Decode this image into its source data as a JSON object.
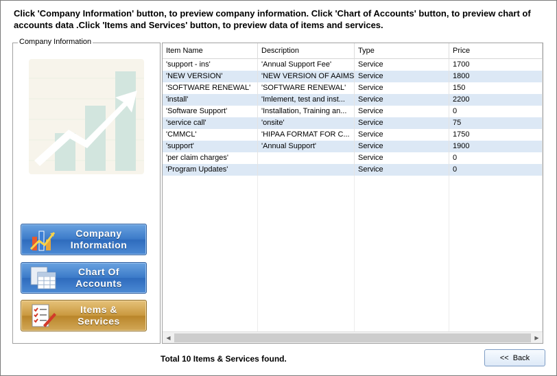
{
  "instructions": "Click 'Company Information' button, to preview company information. Click 'Chart of Accounts' button, to preview chart of accounts data .Click 'Items and Services' button, to preview data of items and services.",
  "groupbox": {
    "legend": "Company Information"
  },
  "nav": {
    "company": {
      "line1": "Company",
      "line2": "Information",
      "icon": "bar-chart-icon"
    },
    "accounts": {
      "line1": "Chart Of",
      "line2": "Accounts",
      "icon": "spreadsheet-icon"
    },
    "items": {
      "line1": "Items &",
      "line2": "Services",
      "icon": "checklist-icon"
    }
  },
  "colors": {
    "row_alt": "#dce8f5",
    "blue_button": "#3a79c8",
    "gold_button": "#c9983e"
  },
  "table": {
    "columns": [
      "Item Name",
      "Description",
      "Type",
      "Price"
    ],
    "rows": [
      [
        "'support - ins'",
        "'Annual Support Fee'",
        "Service",
        "1700"
      ],
      [
        "'NEW VERSION'",
        "'NEW VERSION OF AAIMS'",
        "Service",
        "1800"
      ],
      [
        "'SOFTWARE RENEWAL'",
        "'SOFTWARE RENEWAL'",
        "Service",
        "150"
      ],
      [
        "'install'",
        "'Imlement, test and inst...",
        "Service",
        "2200"
      ],
      [
        "'Software Support'",
        "'Installation, Training an...",
        "Service",
        "0"
      ],
      [
        "'service call'",
        "'onsite'",
        "Service",
        "75"
      ],
      [
        "'CMMCL'",
        "'HIPAA FORMAT FOR C...",
        "Service",
        "1750"
      ],
      [
        "'support'",
        "'Annual Support'",
        "Service",
        "1900"
      ],
      [
        "'per claim charges'",
        "",
        "Service",
        "0"
      ],
      [
        "'Program Updates'",
        "",
        "Service",
        "0"
      ]
    ]
  },
  "status": "Total 10 Items & Services found.",
  "back": {
    "arrow": "<<",
    "label": "Back"
  }
}
